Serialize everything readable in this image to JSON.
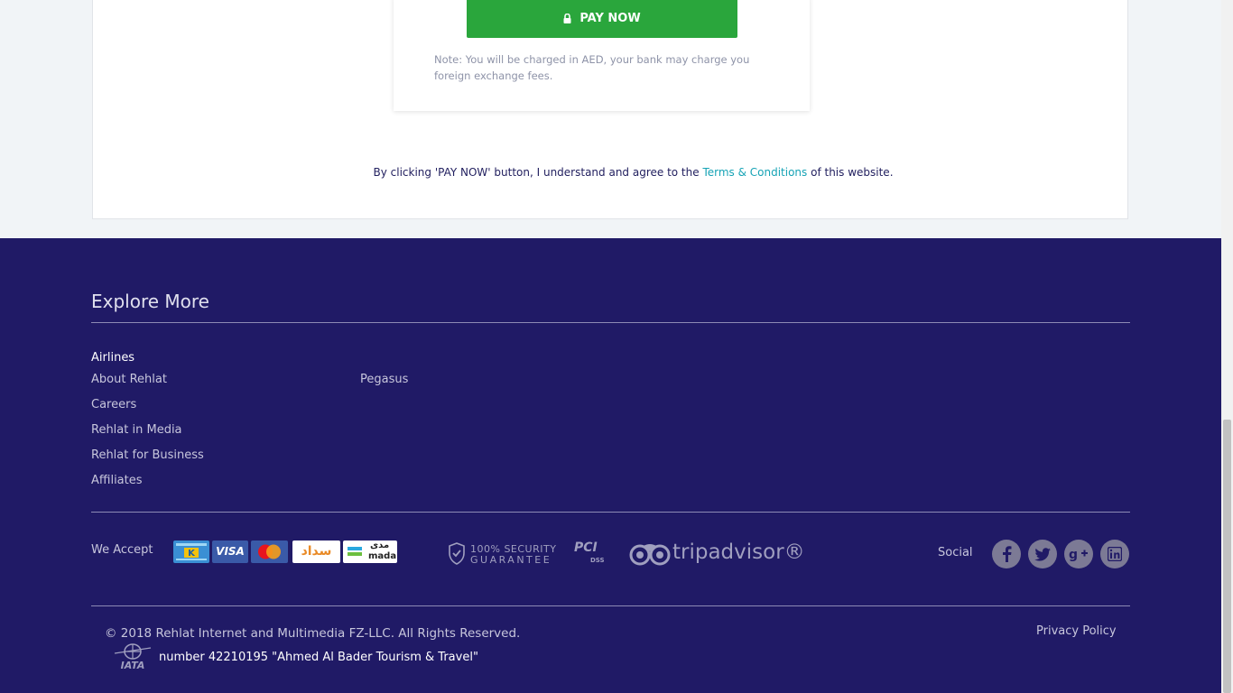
{
  "payment": {
    "pay_button_label": "PAY NOW",
    "note": "Note: You will be charged in AED, your bank may charge you foreign exchange fees.",
    "agree_prefix": "By clicking 'PAY NOW' button, I understand and agree to the ",
    "terms_link": "Terms & Conditions",
    "agree_suffix": " of this website."
  },
  "footer": {
    "explore_title": "Explore More",
    "airlines_heading": "Airlines",
    "links_col1": [
      "About Rehlat",
      "Careers",
      "Rehlat in Media",
      "Rehlat for Business",
      "Affiliates"
    ],
    "links_col2": [
      "Pegasus"
    ],
    "we_accept_label": "We Accept",
    "payment_logos": [
      "knet-logo",
      "visa-logo",
      "mastercard-logo",
      "sadad-logo",
      "mada-logo"
    ],
    "visa_text": "VISA",
    "sadad_text": "سداد",
    "mada_text_ar": "مدى",
    "mada_text": "mada",
    "security_line1": "100% SECURITY",
    "security_line2": "GUARANTEE",
    "pci_text": "PCI",
    "dss_text": "DSS",
    "tripadvisor_text": "tripadvisor®",
    "social_label": "Social",
    "social_icons": [
      "facebook-icon",
      "twitter-icon",
      "google-plus-icon",
      "linkedin-icon"
    ],
    "copyright": "© 2018 Rehlat Internet and Multimedia FZ-LLC. All Rights Reserved.",
    "iata_logo_text": "IATA",
    "iata_number_text": "number 42210195 \"Ahmed Al Bader Tourism & Travel\"",
    "privacy_policy": "Privacy Policy"
  },
  "colors": {
    "footer_bg": "#201a66",
    "pay_button": "#2aa63c",
    "link_accent": "#16a3b5",
    "page_bg": "#f1f4f7"
  }
}
